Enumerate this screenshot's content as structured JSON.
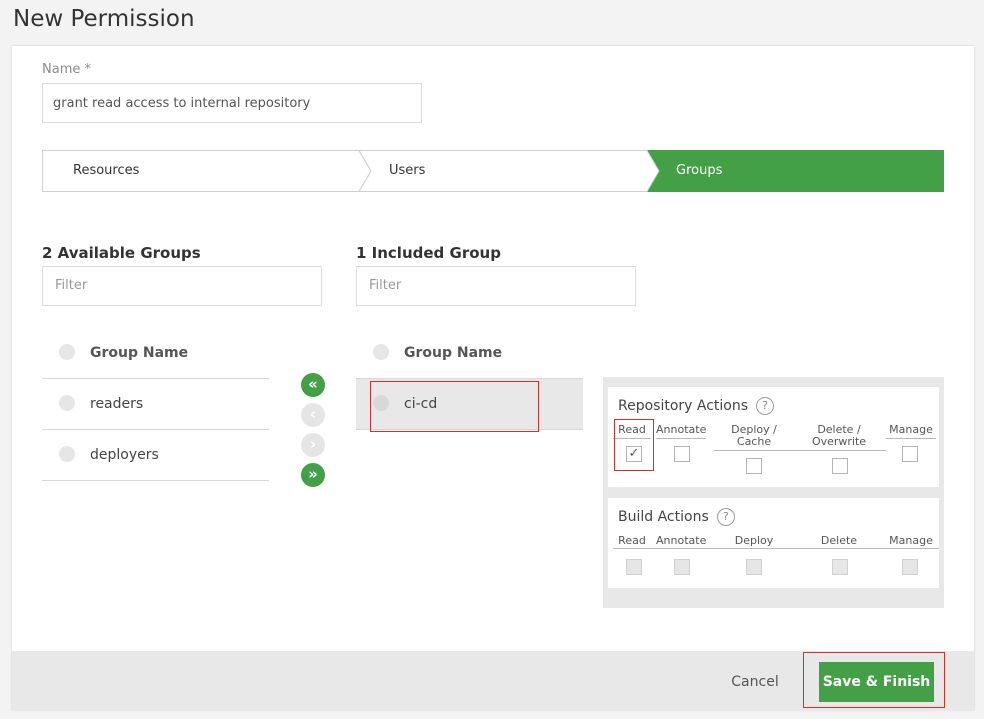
{
  "page": {
    "title": "New Permission"
  },
  "name_field": {
    "label": "Name *",
    "value": "grant read access to internal repository"
  },
  "wizard": {
    "steps": [
      "Resources",
      "Users",
      "Groups"
    ],
    "active": "Groups"
  },
  "available": {
    "title": "2 Available Groups",
    "filter_placeholder": "Filter",
    "column_header": "Group Name",
    "rows": [
      "readers",
      "deployers"
    ]
  },
  "included": {
    "title": "1 Included Group",
    "filter_placeholder": "Filter",
    "column_header": "Group Name",
    "rows": [
      "ci-cd"
    ]
  },
  "move_buttons": {
    "add_all": "«",
    "add": "‹",
    "remove": "›",
    "remove_all": "»"
  },
  "repository_actions": {
    "title": "Repository Actions",
    "help": "?",
    "columns": [
      "Read",
      "Annotate",
      "Deploy / Cache",
      "Delete / Overwrite",
      "Manage"
    ],
    "checked": [
      true,
      false,
      false,
      false,
      false
    ],
    "check_mark": "✓"
  },
  "build_actions": {
    "title": "Build Actions",
    "help": "?",
    "columns": [
      "Read",
      "Annotate",
      "Deploy",
      "Delete",
      "Manage"
    ],
    "checked": [
      false,
      false,
      false,
      false,
      false
    ],
    "disabled": true
  },
  "footer": {
    "cancel": "Cancel",
    "save": "Save & Finish"
  },
  "colors": {
    "accent": "#43a047",
    "highlight": "#d32f2f",
    "selected_row": "#e8e8e8"
  }
}
